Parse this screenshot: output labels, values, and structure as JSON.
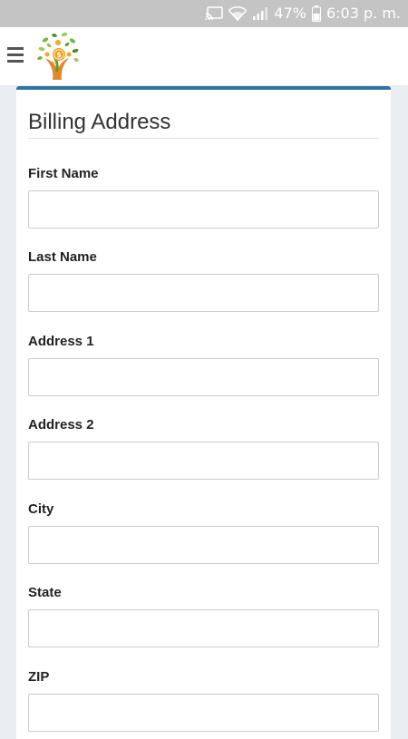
{
  "status_bar": {
    "battery_percent": "47%",
    "time": "6:03 p. m.",
    "icons": [
      "cast-icon",
      "wifi-icon",
      "signal-icon",
      "battery-icon"
    ]
  },
  "header": {
    "menu_icon": "hamburger-menu-icon",
    "logo": "tree-logo"
  },
  "billing": {
    "title": "Billing Address",
    "fields": [
      {
        "label": "First Name",
        "value": "",
        "placeholder": ""
      },
      {
        "label": "Last Name",
        "value": "",
        "placeholder": ""
      },
      {
        "label": "Address 1",
        "value": "",
        "placeholder": ""
      },
      {
        "label": "Address 2",
        "value": "",
        "placeholder": ""
      },
      {
        "label": "City",
        "value": "",
        "placeholder": ""
      },
      {
        "label": "State",
        "value": "",
        "placeholder": ""
      },
      {
        "label": "ZIP",
        "value": "",
        "placeholder": ""
      }
    ]
  },
  "colors": {
    "status_bar_bg": "#c4c4c4",
    "page_bg": "#eaedf1",
    "card_accent": "#2e74a6",
    "input_border": "#cccccc"
  }
}
